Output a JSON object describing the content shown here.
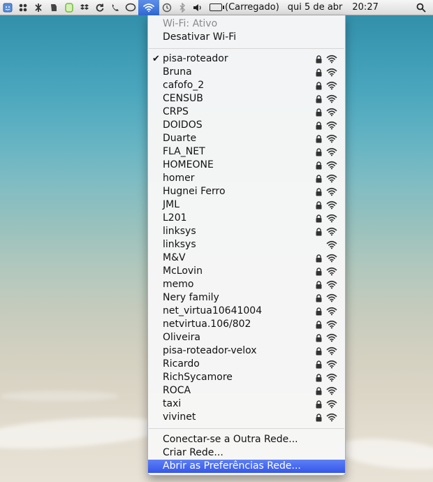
{
  "menubar": {
    "status": "(Carregado)",
    "date": "qui 5 de abr",
    "time": "20:27",
    "icons": [
      "finder-icon",
      "grid-icon",
      "bluetooth-tool-icon",
      "evernote-icon",
      "green-app-icon",
      "dropbox-icon",
      "sync-icon",
      "phone-icon",
      "chat-icon",
      "wifi-icon",
      "time-machine-icon",
      "bluetooth-icon",
      "volume-icon",
      "battery-icon",
      "spotlight-icon"
    ]
  },
  "wifi_menu": {
    "status": "Wi-Fi: Ativo",
    "toggle": "Desativar Wi-Fi",
    "networks": [
      {
        "name": "pisa-roteador",
        "connected": true
      },
      {
        "name": "Bruna"
      },
      {
        "name": "cafofo_2"
      },
      {
        "name": "CENSUB"
      },
      {
        "name": "CRPS"
      },
      {
        "name": "DOIDOS"
      },
      {
        "name": "Duarte"
      },
      {
        "name": "FLA_NET"
      },
      {
        "name": "HOMEONE"
      },
      {
        "name": "homer"
      },
      {
        "name": "Hugnei Ferro"
      },
      {
        "name": "JML"
      },
      {
        "name": "L201"
      },
      {
        "name": "linksys"
      },
      {
        "name": "linksys",
        "open": true
      },
      {
        "name": "M&V"
      },
      {
        "name": "McLovin"
      },
      {
        "name": "memo"
      },
      {
        "name": "Nery family"
      },
      {
        "name": "net_virtua10641004"
      },
      {
        "name": "netvirtua.106/802"
      },
      {
        "name": "Oliveira"
      },
      {
        "name": "pisa-roteador-velox"
      },
      {
        "name": "Ricardo"
      },
      {
        "name": "RichSycamore"
      },
      {
        "name": "ROCA"
      },
      {
        "name": "taxi"
      },
      {
        "name": "vivinet"
      }
    ],
    "other_network": "Conectar-se a Outra Rede...",
    "create_network": "Criar Rede...",
    "open_preferences": "Abrir as Preferências Rede..."
  },
  "colors": {
    "highlight": "#3f63ee",
    "menubar_active": "#3f6fd9"
  }
}
